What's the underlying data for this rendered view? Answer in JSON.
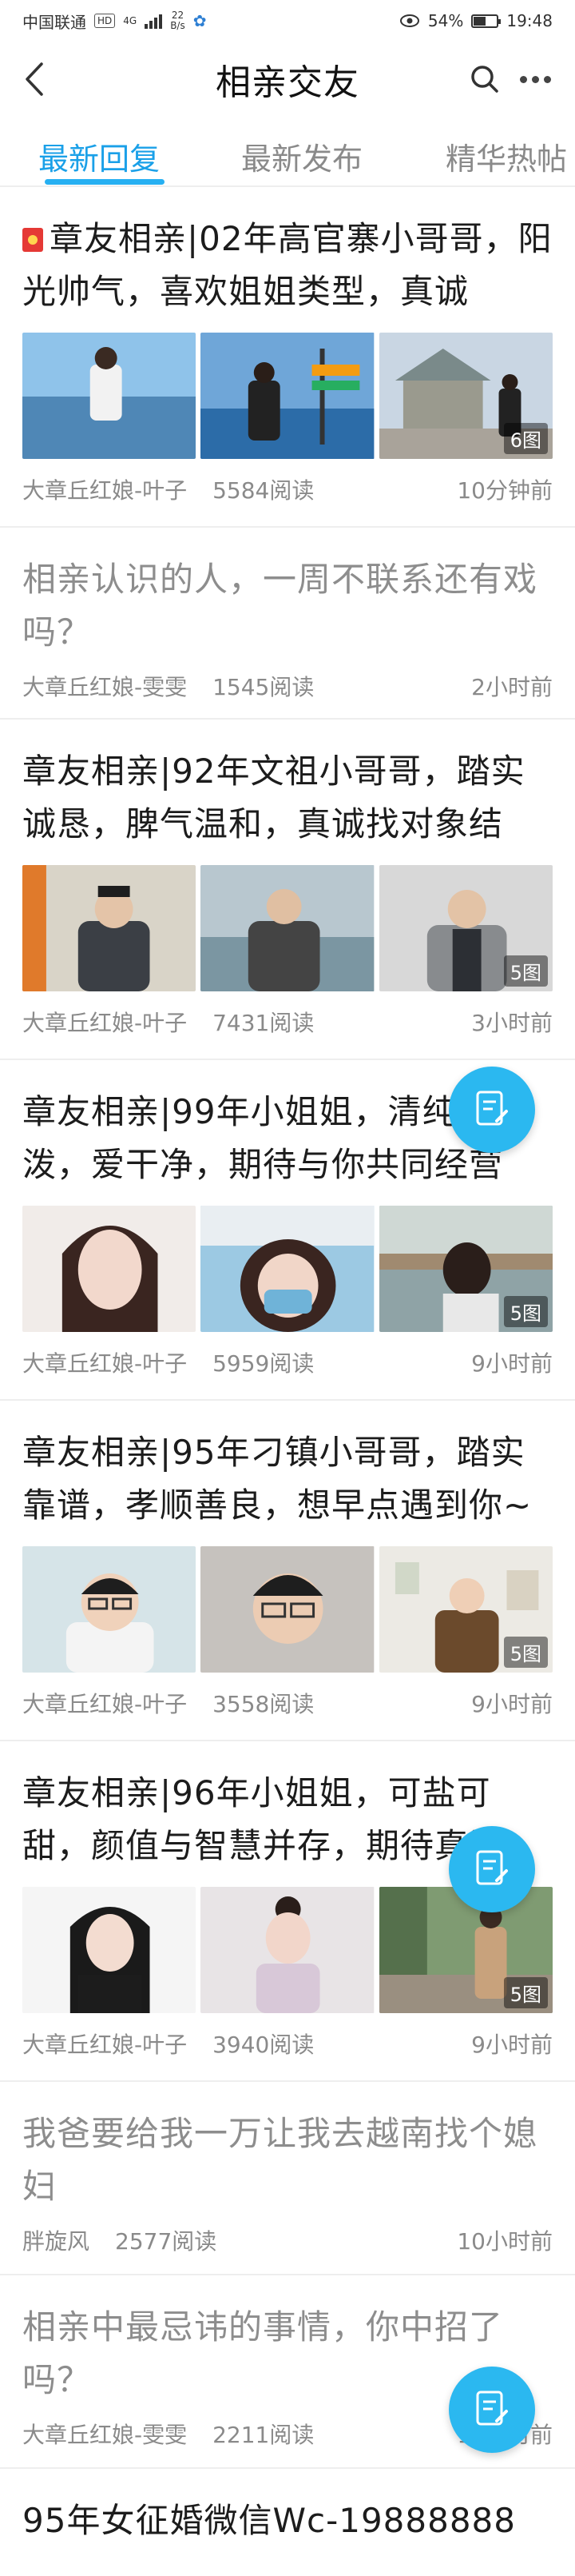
{
  "status_bar": {
    "carrier": "中国联通",
    "hd_badge": "HD",
    "network": "4G",
    "speed_value": "22",
    "speed_unit": "B/s",
    "battery_percent": "54%",
    "battery_level": 0.54,
    "time": "19:48"
  },
  "header": {
    "title": "相亲交友",
    "back_icon": "chevron-left-icon",
    "search_icon": "search-icon",
    "more_icon": "more-dots-icon"
  },
  "tabs": [
    {
      "label": "最新回复",
      "active": true
    },
    {
      "label": "最新发布",
      "active": false
    },
    {
      "label": "精华热帖",
      "active": false
    }
  ],
  "accent_color": "#1aa0e8",
  "fab_icon": "edit-post-icon",
  "posts": [
    {
      "title": "章友相亲|02年高官寨小哥哥，阳光帅气，喜欢姐姐类型，真诚",
      "has_red_icon": true,
      "images": [
        "beach-photo",
        "street-sign-photo",
        "pavilion-photo"
      ],
      "image_count": "6图",
      "author": "大章丘红娘-叶子",
      "reads": "5584阅读",
      "time": "10分钟前"
    },
    {
      "title": "相亲认识的人，一周不联系还有戏吗？",
      "read": true,
      "author": "大章丘红娘-雯雯",
      "reads": "1545阅读",
      "time": "2小时前"
    },
    {
      "title": "章友相亲|92年文祖小哥哥，踏实诚恳，脾气温和，真诚找对象结",
      "images": [
        "portrait-photo",
        "portrait-photo",
        "portrait-photo"
      ],
      "image_count": "5图",
      "author": "大章丘红娘-叶子",
      "reads": "7431阅读",
      "time": "3小时前"
    },
    {
      "title": "章友相亲|99年小姐姐，清纯活泼，爱干净，期待与你共同经营",
      "images": [
        "portrait-photo",
        "selfie-photo",
        "outdoor-photo"
      ],
      "image_count": "5图",
      "author": "大章丘红娘-叶子",
      "reads": "5959阅读",
      "time": "9小时前"
    },
    {
      "title": "章友相亲|95年刁镇小哥哥，踏实靠谱，孝顺善良，想早点遇到你~",
      "images": [
        "portrait-photo",
        "portrait-photo",
        "portrait-photo"
      ],
      "image_count": "5图",
      "author": "大章丘红娘-叶子",
      "reads": "3558阅读",
      "time": "9小时前"
    },
    {
      "title": "章友相亲|96年小姐姐，可盐可甜，颜值与智慧并存，期待真诚",
      "images": [
        "portrait-photo",
        "selfie-photo",
        "street-photo"
      ],
      "image_count": "5图",
      "author": "大章丘红娘-叶子",
      "reads": "3940阅读",
      "time": "9小时前"
    },
    {
      "title": "我爸要给我一万让我去越南找个媳妇",
      "read": true,
      "author": "胖旋风",
      "reads": "2577阅读",
      "time": "10小时前"
    },
    {
      "title": "相亲中最忌讳的事情，你中招了吗？",
      "read": true,
      "author": "大章丘红娘-雯雯",
      "reads": "2211阅读",
      "time": "11小时前"
    },
    {
      "title": "95年女征婚微信Wc-19888888"
    }
  ]
}
